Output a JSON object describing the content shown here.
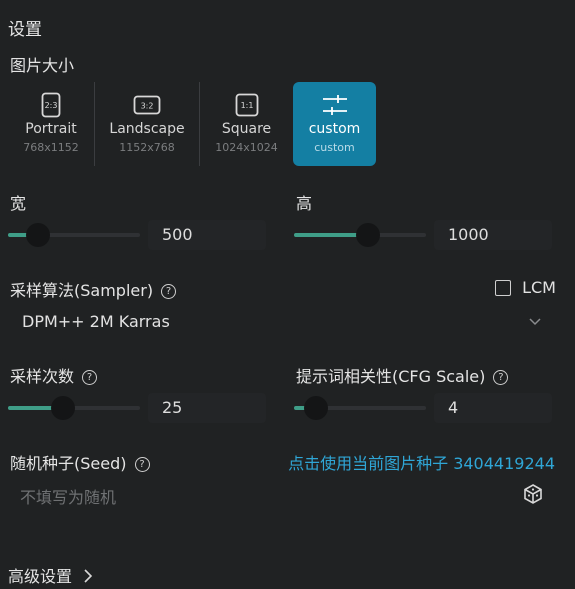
{
  "title": "设置",
  "image_size": {
    "label": "图片大小",
    "options": [
      {
        "icon": "portrait-ratio-icon",
        "icon_text": "2:3",
        "name": "Portrait",
        "dims": "768x1152",
        "selected": false
      },
      {
        "icon": "landscape-ratio-icon",
        "icon_text": "3:2",
        "name": "Landscape",
        "dims": "1152x768",
        "selected": false
      },
      {
        "icon": "square-ratio-icon",
        "icon_text": "1:1",
        "name": "Square",
        "dims": "1024x1024",
        "selected": false
      },
      {
        "icon": "sliders-icon",
        "icon_text": "",
        "name": "custom",
        "dims": "custom",
        "selected": true
      }
    ]
  },
  "width": {
    "label": "宽",
    "value": "500",
    "level": 0.23
  },
  "height": {
    "label": "高",
    "value": "1000",
    "level": 0.56
  },
  "sampler": {
    "label": "采样算法(Sampler)",
    "help": "?",
    "lcm_label": "LCM",
    "lcm_checked": false,
    "selected": "DPM++ 2M Karras"
  },
  "steps": {
    "label": "采样次数",
    "help": "?",
    "value": "25",
    "level": 0.42
  },
  "cfg": {
    "label": "提示词相关性(CFG Scale)",
    "help": "?",
    "value": "4",
    "level": 0.17
  },
  "seed": {
    "label": "随机种子(Seed)",
    "help": "?",
    "use_current": "点击使用当前图片种子 3404419244",
    "placeholder": "不填写为随机"
  },
  "advanced": {
    "label": "高级设置"
  },
  "colors": {
    "accent": "#147fa3",
    "slider": "#3f9e88",
    "link": "#2fa6d6",
    "background": "#202223"
  }
}
